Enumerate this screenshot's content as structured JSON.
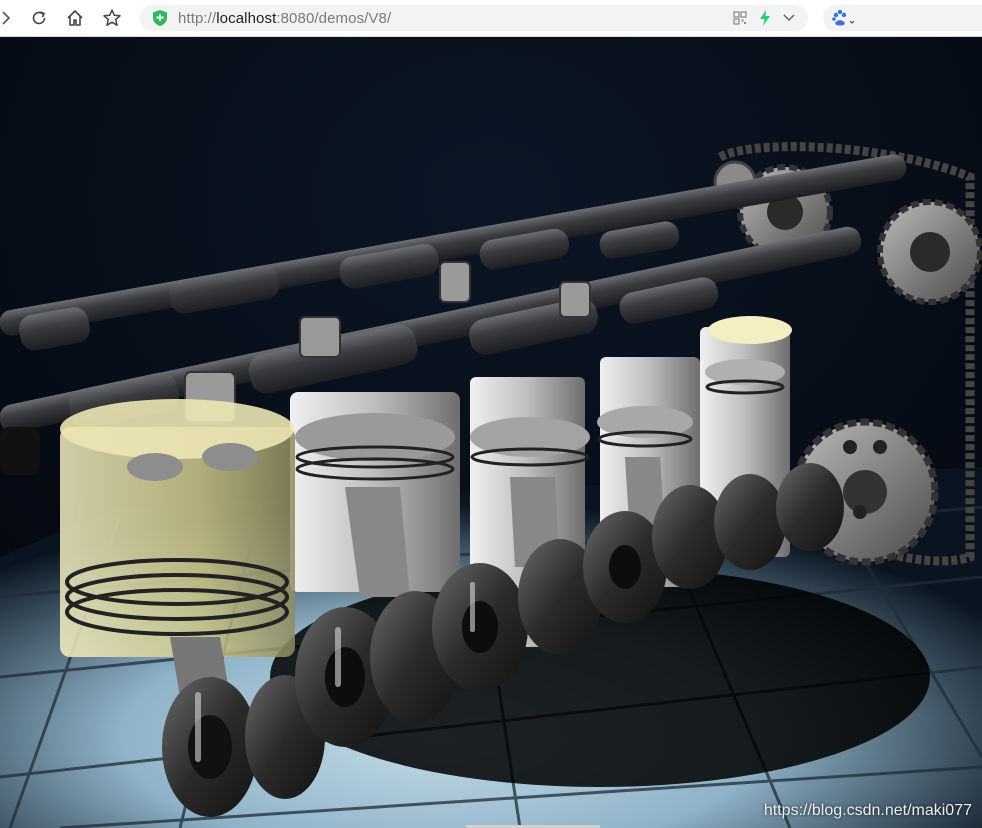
{
  "browser": {
    "url_scheme": "http://",
    "url_host": "localhost",
    "url_rest": ":8080/demos/V8/",
    "icons": {
      "reload": "reload-icon",
      "home": "home-icon",
      "bookmark": "star-icon",
      "security": "shield-icon",
      "qr": "qr-code-icon",
      "accelerate": "lightning-icon",
      "dropdown": "chevron-down-icon",
      "search_engine": "baidu-paw-icon"
    },
    "colors": {
      "security_green": "#2dbb5a",
      "lightning_green": "#2ecc71",
      "baidu_blue": "#3b6fe0"
    }
  },
  "scene": {
    "description_icon": "v8-engine-3d-render",
    "watermark": "https://blog.csdn.net/maki077",
    "colors": {
      "background": "#050a14",
      "floor": "#9fc3d8",
      "metal": "#7a7c80",
      "piston_highlight": "#e8e3a8"
    }
  }
}
